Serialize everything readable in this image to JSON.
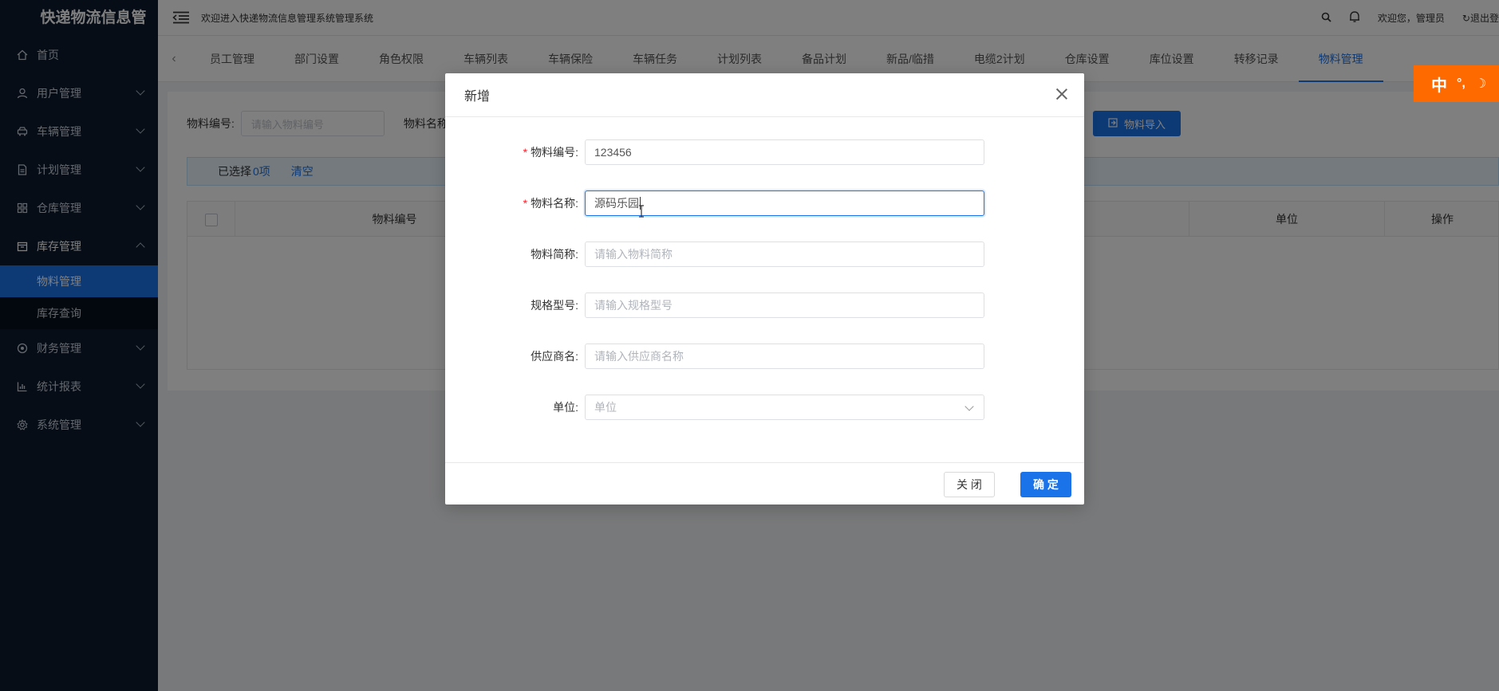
{
  "app": {
    "title": "快递物流信息管",
    "welcome": "欢迎进入快递物流信息管理系统管理系统"
  },
  "header": {
    "user_text": "欢迎您，管理员",
    "logout": "退出登"
  },
  "sidebar": {
    "items": [
      {
        "label": "首页",
        "icon": "home-icon"
      },
      {
        "label": "用户管理",
        "icon": "user-icon"
      },
      {
        "label": "车辆管理",
        "icon": "car-icon"
      },
      {
        "label": "计划管理",
        "icon": "document-icon"
      },
      {
        "label": "仓库管理",
        "icon": "grid-icon"
      },
      {
        "label": "库存管理",
        "icon": "inventory-icon"
      },
      {
        "label": "财务管理",
        "icon": "finance-icon"
      },
      {
        "label": "统计报表",
        "icon": "chart-icon"
      },
      {
        "label": "系统管理",
        "icon": "settings-icon"
      }
    ],
    "submenu": [
      {
        "label": "物料管理",
        "active": true
      },
      {
        "label": "库存查询",
        "active": false
      }
    ]
  },
  "tabs": [
    "员工管理",
    "部门设置",
    "角色权限",
    "车辆列表",
    "车辆保险",
    "车辆任务",
    "计划列表",
    "备品计划",
    "新品/临措",
    "电缆2计划",
    "仓库设置",
    "库位设置",
    "转移记录",
    "物料管理"
  ],
  "active_tab": "物料管理",
  "main": {
    "search_label_code": "物料编号:",
    "search_placeholder_code": "请输入物料编号",
    "search_label_name": "物料名称",
    "import_button": "物料导入",
    "selection_prefix": "已选择",
    "selection_count": "0项",
    "clear_label": "清空",
    "columns": {
      "code": "物料编号",
      "unit": "单位",
      "action": "操作"
    }
  },
  "dialog": {
    "title": "新增",
    "fields": {
      "code_label": "物料编号:",
      "code_value": "123456",
      "name_label": "物料名称:",
      "name_value": "源码乐园",
      "short_label": "物料简称:",
      "short_placeholder": "请输入物料简称",
      "spec_label": "规格型号:",
      "spec_placeholder": "请输入规格型号",
      "supplier_label": "供应商名:",
      "supplier_placeholder": "请输入供应商名称",
      "unit_label": "单位:",
      "unit_placeholder": "单位"
    },
    "close_button": "关 闭",
    "ok_button": "确 定"
  },
  "ime": {
    "mode": "中",
    "punct": "°,",
    "moon": "☽"
  },
  "colors": {
    "sidebar_bg": "#0c1a2e",
    "accent": "#1a73e8",
    "ime_orange": "#ff6a00",
    "required": "#f5222d"
  }
}
